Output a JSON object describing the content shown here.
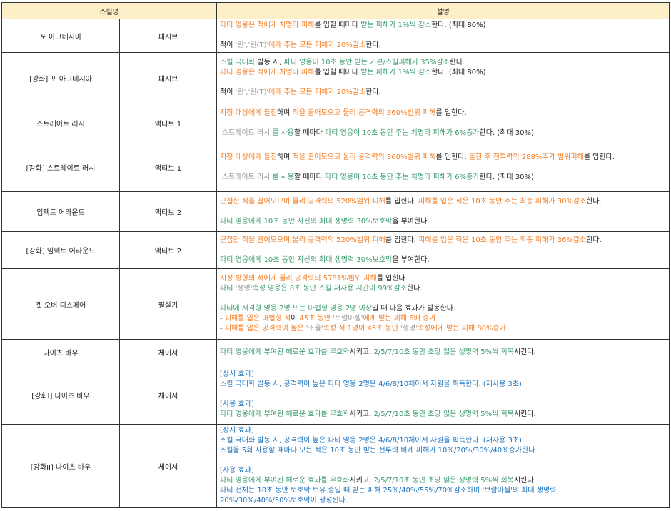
{
  "header": {
    "skill": "스킬명",
    "desc": "설명"
  },
  "colors": {
    "o": "#f47b20",
    "g": "#3a9a6c",
    "b": "#1e73be",
    "k": "#222222",
    "s": "#9a9a9a",
    "header_bg": "#fdf0c8"
  },
  "rows": [
    {
      "name": "포 아그네시아",
      "type": "패시브",
      "lines": [
        [
          {
            "t": "파티 영웅은 적에게 치명타 피해",
            "c": "o"
          },
          {
            "t": "를 입힐 때마다 ",
            "c": "k"
          },
          {
            "t": "받는 피해가 1%씩 감소",
            "c": "g"
          },
          {
            "t": "한다. (최대 80%)",
            "c": "k"
          }
        ],
        [],
        [
          {
            "t": "적이 ",
            "c": "k"
          },
          {
            "t": "'린','린(T)'",
            "c": "s"
          },
          {
            "t": "에게 주는 모든 피해가 20%감소",
            "c": "o"
          },
          {
            "t": "한다.",
            "c": "k"
          }
        ]
      ]
    },
    {
      "name": "[강화] 포 아그네시아",
      "type": "패시브",
      "lines": [
        [
          {
            "t": "스킬 극대화",
            "c": "g"
          },
          {
            "t": " 발동 시, ",
            "c": "k"
          },
          {
            "t": "파티 영웅이 10초 동안 받는 기본/스킬피해가 35%감소",
            "c": "g"
          },
          {
            "t": "한다.",
            "c": "k"
          }
        ],
        [
          {
            "t": "파티 영웅은 적에게 치명타 피해",
            "c": "o"
          },
          {
            "t": "를 입힐 때마다 ",
            "c": "k"
          },
          {
            "t": "받는 피해가 1%씩 감소",
            "c": "g"
          },
          {
            "t": "한다. (최대 80%)",
            "c": "k"
          }
        ],
        [],
        [
          {
            "t": "적이 ",
            "c": "k"
          },
          {
            "t": "'린','린(T)'",
            "c": "s"
          },
          {
            "t": "에게 주는 모든 피해가 20%감소",
            "c": "o"
          },
          {
            "t": "한다.",
            "c": "k"
          }
        ]
      ]
    },
    {
      "name": "스트레이트 러시",
      "type": "액티브 1",
      "lines": [
        [
          {
            "t": "지정 대상에게 돌진",
            "c": "o"
          },
          {
            "t": "하며 ",
            "c": "k"
          },
          {
            "t": "적을 끌어모으고 물리 공격력의 360%범위 피해",
            "c": "o"
          },
          {
            "t": "를 입힌다.",
            "c": "k"
          }
        ],
        [],
        [
          {
            "t": "'스트레이트 러시'",
            "c": "s"
          },
          {
            "t": "를 사용",
            "c": "g"
          },
          {
            "t": "할 때마다 ",
            "c": "k"
          },
          {
            "t": "파티 영웅이 10초 동안 주는 치명타 피해가 6%증가",
            "c": "g"
          },
          {
            "t": "한다. (최대 30%)",
            "c": "k"
          }
        ]
      ]
    },
    {
      "name": "[강화] 스트레이트 러시",
      "type": "액티브 1",
      "lines": [
        [
          {
            "t": "지정 대상에게 돌진",
            "c": "o"
          },
          {
            "t": "하며 ",
            "c": "k"
          },
          {
            "t": "적을 끌어모으고 물리 공격력의 360%범위 피해",
            "c": "o"
          },
          {
            "t": "를 입힌다. ",
            "c": "k"
          },
          {
            "t": "돌진 후 전투력의 288%추가 범위피해",
            "c": "o"
          },
          {
            "t": "를 입힌다.",
            "c": "k"
          }
        ],
        [],
        [
          {
            "t": "'스트레이트 러시'",
            "c": "s"
          },
          {
            "t": "를 사용",
            "c": "g"
          },
          {
            "t": "할 때마다 ",
            "c": "k"
          },
          {
            "t": "파티 영웅이 10초 동안 주는 치명타 피해가 6%증가",
            "c": "g"
          },
          {
            "t": "한다. (최대 30%)",
            "c": "k"
          }
        ]
      ]
    },
    {
      "name": "임펙트 어라운드",
      "type": "액티브 2",
      "lines": [
        [
          {
            "t": "근접한 적을 끌어모으며 물리 공격력의 520%범위 피해",
            "c": "o"
          },
          {
            "t": "를 입힌다. ",
            "c": "k"
          },
          {
            "t": "피해를 입은 적은 10초 동안 주는 최종 피해가 30%감소",
            "c": "o"
          },
          {
            "t": "한다.",
            "c": "k"
          }
        ],
        [],
        [
          {
            "t": "파티 영웅에게 10초 동안 자신의 최대 생명력 30%보호막",
            "c": "g"
          },
          {
            "t": "을 부여한다.",
            "c": "k"
          }
        ]
      ]
    },
    {
      "name": "[강화] 임펙트 어라운드",
      "type": "액티브 2",
      "lines": [
        [
          {
            "t": "근접한 적을 끌어모으며 물리 공격력의 520%범위 피해",
            "c": "o"
          },
          {
            "t": "를 입힌다. ",
            "c": "k"
          },
          {
            "t": "피해를 입은 적은 10초 동안 주는 최종 피해가 36%감소",
            "c": "o"
          },
          {
            "t": "한다.",
            "c": "k"
          }
        ],
        [],
        [
          {
            "t": "파티 영웅에게 10초 동안 자신의 최대 생명력 30%보호막",
            "c": "g"
          },
          {
            "t": "을 부여한다.",
            "c": "k"
          }
        ]
      ]
    },
    {
      "name": "겟 오버 디스페어",
      "type": "필살기",
      "lines": [
        [
          {
            "t": "지정 방향의 적에게 물리 공격력의 5781%범위 피해",
            "c": "o"
          },
          {
            "t": "를 입힌다.",
            "c": "k"
          }
        ],
        [
          {
            "t": "파티 ",
            "c": "g"
          },
          {
            "t": "'생명'",
            "c": "s"
          },
          {
            "t": "속성 영웅은 8초 동안 스킬 재사용 시간이 99%감소",
            "c": "g"
          },
          {
            "t": "한다.",
            "c": "k"
          }
        ],
        [],
        [
          {
            "t": "파티에 저격형 영웅 2명 또는 마법형 영웅 2명 이상",
            "c": "g"
          },
          {
            "t": "일 때 다음 효과가 발동한다.",
            "c": "k"
          }
        ],
        [
          {
            "t": "- ",
            "c": "k"
          },
          {
            "t": "피해를 입은 마법형 적",
            "c": "o"
          },
          {
            "t": "이 ",
            "c": "k"
          },
          {
            "t": "45초 동안 ",
            "c": "o"
          },
          {
            "t": "'브람마셸'",
            "c": "s"
          },
          {
            "t": "에게 받는 피해 6배 증가",
            "c": "o"
          }
        ],
        [
          {
            "t": "- ",
            "c": "k"
          },
          {
            "t": "피해를 입은 공격력이 높은 ",
            "c": "o"
          },
          {
            "t": "'조율'",
            "c": "s"
          },
          {
            "t": "속성 적 1명이 45초 동안 ",
            "c": "o"
          },
          {
            "t": "'생명'",
            "c": "s"
          },
          {
            "t": "속성에게 받는 피해 80%증가",
            "c": "o"
          }
        ]
      ]
    },
    {
      "name": "나이츠 바우",
      "type": "체이서",
      "lines": [
        [
          {
            "t": "파티 영웅에게 부여된 해로운 효과를 무효화",
            "c": "g"
          },
          {
            "t": "시키고, ",
            "c": "k"
          },
          {
            "t": "2/5/7/10초 동안 초당 잃은 생명력 5%씩 회복",
            "c": "g"
          },
          {
            "t": "시킨다.",
            "c": "k"
          }
        ]
      ]
    },
    {
      "name": "[강화I] 나이츠 바우",
      "type": "체이서",
      "lines": [
        [
          {
            "t": "[상시 효과]",
            "c": "b"
          }
        ],
        [
          {
            "t": "스킬 극대화 발동 시, 공격력이 높은 파티 영웅 2명은 4/6/8/10체이서 자원을 획득한다. (재사용 3초)",
            "c": "b"
          }
        ],
        [],
        [
          {
            "t": "[사용 효과]",
            "c": "b"
          }
        ],
        [
          {
            "t": "파티 영웅에게 부여된 해로운 효과를 무효화",
            "c": "g"
          },
          {
            "t": "시키고, ",
            "c": "k"
          },
          {
            "t": "2/5/7/10초 동안 초당 잃은 생명력 5%씩 회복",
            "c": "g"
          },
          {
            "t": "시킨다.",
            "c": "k"
          }
        ]
      ]
    },
    {
      "name": "[강화II] 나이츠 바우",
      "type": "체이서",
      "lines": [
        [
          {
            "t": "[상시 효과]",
            "c": "b"
          }
        ],
        [
          {
            "t": "스킬 극대화 발동 시, 공격력이 높은 파티 영웅 2명은 4/6/8/10체이서 자원을 획득한다. (재사용 3초)",
            "c": "b"
          }
        ],
        [
          {
            "t": "스킬을 5회 사용할 때마다 모든 적은 10초 동안 받는 전투력 비례 피해가 10%/20%/30%/40%증가한다.",
            "c": "b"
          }
        ],
        [],
        [
          {
            "t": "[사용 효과]",
            "c": "b"
          }
        ],
        [
          {
            "t": "파티 영웅에게 부여된 해로운 효과를 무효화",
            "c": "g"
          },
          {
            "t": "시키고, ",
            "c": "k"
          },
          {
            "t": "2/5/7/10초 동안 초당 잃은 생명력 5%씩 회복",
            "c": "g"
          },
          {
            "t": "시킨다.",
            "c": "k"
          }
        ],
        [
          {
            "t": "파티 전체는 10초 동안 보호막 보유 중일 때 받는 피해 25%/40%/55%/70%감소하며 '브람마셸'의 최대 생명력",
            "c": "b"
          }
        ],
        [
          {
            "t": "20%/30%/40%/50%보호막이 생성된다.",
            "c": "b"
          }
        ]
      ]
    }
  ]
}
